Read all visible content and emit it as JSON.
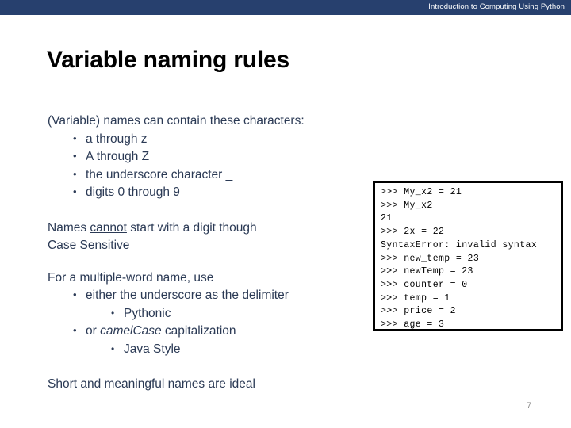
{
  "header": {
    "title": "Introduction to Computing Using Python",
    "bar_color": "#27406E"
  },
  "slide": {
    "title": "Variable naming rules",
    "title_color": "#000000",
    "body_color": "#2B3A55",
    "page_number": "7"
  },
  "body": {
    "lead": "(Variable) names can contain these characters:",
    "charset_bullets": [
      "a through z",
      "A through Z",
      "the underscore character _",
      "digits 0 through 9"
    ],
    "rule_digit_prefix": "Names ",
    "rule_digit_underlined": "cannot",
    "rule_digit_suffix": " start with a digit though",
    "rule_case": "Case Sensitive",
    "multiword_lead": "For a multiple-word name, use",
    "multiword_option_1": "either the underscore as the delimiter",
    "multiword_option_1_sub": "Pythonic",
    "multiword_option_2_prefix": "or ",
    "multiword_option_2_italic": "camelCase",
    "multiword_option_2_suffix": " capitalization",
    "multiword_option_2_sub": "Java Style",
    "closing": "Short and meaningful names are ideal"
  },
  "code_box": {
    "lines": [
      ">>> My_x2 = 21",
      ">>> My_x2",
      "21",
      ">>> 2x = 22",
      "SyntaxError: invalid syntax",
      ">>> new_temp = 23",
      ">>> newTemp = 23",
      ">>> counter = 0",
      ">>> temp = 1",
      ">>> price = 2",
      ">>> age = 3"
    ]
  }
}
